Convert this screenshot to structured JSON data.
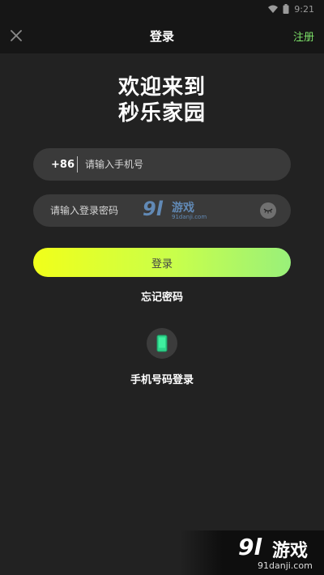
{
  "status_bar": {
    "time": "9:21",
    "icons": [
      "wifi-icon",
      "battery-icon"
    ]
  },
  "nav": {
    "close_icon": "close-icon",
    "title": "登录",
    "register_label": "注册",
    "register_color": "#7ee36a"
  },
  "welcome": {
    "line1": "欢迎来到",
    "line2": "秒乐家园"
  },
  "phone_field": {
    "country_code": "+86",
    "placeholder": "请输入手机号",
    "value": ""
  },
  "password_field": {
    "placeholder": "请输入登录密码",
    "value": "",
    "toggle_icon": "eye-closed-icon"
  },
  "login_button": {
    "label": "登录",
    "gradient_start": "#f1ff1a",
    "gradient_end": "#99f07a"
  },
  "forgot_password": "忘记密码",
  "phone_login": {
    "icon": "mobile-phone-icon",
    "icon_color": "#2ed38a",
    "label": "手机号码登录"
  },
  "watermark": {
    "logo_number": "9l",
    "logo_text": "游戏",
    "url": "91danji.com"
  }
}
